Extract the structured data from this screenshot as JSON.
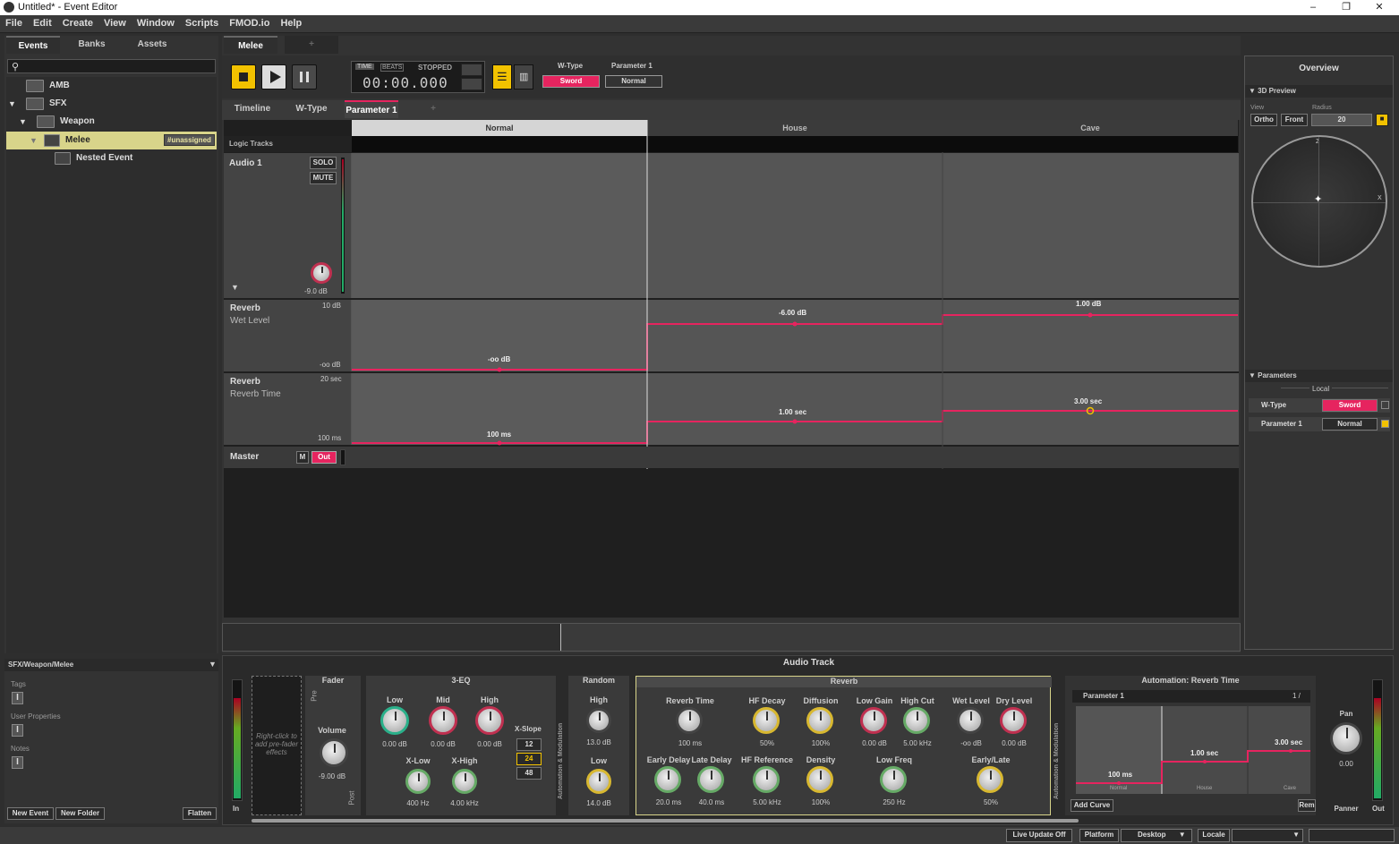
{
  "window": {
    "title": "Untitled* - Event Editor",
    "min": "–",
    "max": "❐",
    "close": "✕"
  },
  "menu": [
    "File",
    "Edit",
    "Create",
    "View",
    "Window",
    "Scripts",
    "FMOD.io",
    "Help"
  ],
  "browser": {
    "tabs": [
      "Events",
      "Banks",
      "Assets"
    ],
    "search_placeholder": "",
    "tree": [
      {
        "label": "AMB",
        "level": 0
      },
      {
        "label": "SFX",
        "level": 0
      },
      {
        "label": "Weapon",
        "level": 1
      },
      {
        "label": "Melee",
        "level": 2,
        "badge": "#unassigned"
      },
      {
        "label": "Nested Event",
        "level": 3
      }
    ],
    "path": "SFX/Weapon/Melee",
    "sections": [
      "Tags",
      "User Properties",
      "Notes"
    ],
    "buttons": {
      "new_event": "New Event",
      "new_folder": "New Folder",
      "flatten": "Flatten"
    }
  },
  "editor": {
    "event_tabs": [
      "Melee",
      "+"
    ],
    "transport": {
      "time_label": "TIME",
      "beats_label": "BEATS",
      "status": "STOPPED",
      "timecode": "00:00.000"
    },
    "param_widgets": [
      {
        "label": "W-Type",
        "value": "Sword"
      },
      {
        "label": "Parameter 1",
        "value": "Normal"
      }
    ],
    "sheet_tabs": [
      "Timeline",
      "W-Type",
      "Parameter 1",
      "+"
    ],
    "columns": [
      "Normal",
      "House",
      "Cave"
    ],
    "logic_tracks": "Logic Tracks",
    "audio_track": {
      "name": "Audio 1",
      "solo": "SOLO",
      "mute": "MUTE",
      "volume": "-9.0 dB"
    },
    "automation_tracks": [
      {
        "effect": "Reverb",
        "param": "Wet Level",
        "max": "10 dB",
        "min": "-oo dB",
        "points": [
          {
            "label": "-oo dB"
          },
          {
            "label": "-6.00 dB"
          },
          {
            "label": "1.00 dB"
          }
        ]
      },
      {
        "effect": "Reverb",
        "param": "Reverb Time",
        "max": "20 sec",
        "min": "100 ms",
        "points": [
          {
            "label": "100 ms"
          },
          {
            "label": "1.00 sec"
          },
          {
            "label": "3.00 sec"
          }
        ]
      }
    ],
    "master": {
      "name": "Master",
      "m": "M",
      "out": "Out"
    }
  },
  "overview": {
    "title": "Overview",
    "preview": {
      "title": "3D Preview",
      "view_label": "View",
      "radius_label": "Radius",
      "ortho": "Ortho",
      "front": "Front",
      "radius": "20",
      "z": "Z",
      "x": "X"
    },
    "parameters": {
      "title": "Parameters",
      "local": "Local",
      "items": [
        {
          "name": "W-Type",
          "value": "Sword"
        },
        {
          "name": "Parameter 1",
          "value": "Normal"
        }
      ]
    }
  },
  "deck": {
    "title": "Audio Track",
    "in": "In",
    "out": "Out",
    "prefader_hint": "Right-click to add pre-fader effects",
    "fader": {
      "title": "Fader",
      "pre": "Pre",
      "post": "Post",
      "volume_label": "Volume",
      "volume": "-9.00 dB"
    },
    "eq": {
      "title": "3-EQ",
      "knobs": [
        {
          "label": "Low",
          "value": "0.00 dB"
        },
        {
          "label": "Mid",
          "value": "0.00 dB"
        },
        {
          "label": "High",
          "value": "0.00 dB"
        },
        {
          "label": "X-Low",
          "value": "400 Hz"
        },
        {
          "label": "X-High",
          "value": "4.00 kHz"
        }
      ],
      "xslope_label": "X-Slope",
      "slopes": [
        "12",
        "24",
        "48"
      ]
    },
    "automation_side": "Automation & Modulation",
    "random": {
      "title": "Random",
      "knobs": [
        {
          "label": "High",
          "value": "13.0 dB"
        },
        {
          "label": "Low",
          "value": "14.0 dB"
        }
      ]
    },
    "reverb": {
      "title": "Reverb",
      "knobs": [
        {
          "label": "Reverb Time",
          "value": "100 ms"
        },
        {
          "label": "HF Decay",
          "value": "50%"
        },
        {
          "label": "Diffusion",
          "value": "100%"
        },
        {
          "label": "Low Gain",
          "value": "0.00 dB"
        },
        {
          "label": "High Cut",
          "value": "5.00 kHz"
        },
        {
          "label": "Wet Level",
          "value": "-oo dB"
        },
        {
          "label": "Dry Level",
          "value": "0.00 dB"
        },
        {
          "label": "Early Delay",
          "value": "20.0 ms"
        },
        {
          "label": "Late Delay",
          "value": "40.0 ms"
        },
        {
          "label": "HF Reference",
          "value": "5.00 kHz"
        },
        {
          "label": "Density",
          "value": "100%"
        },
        {
          "label": "Low Freq",
          "value": "250 Hz"
        },
        {
          "label": "Early/Late",
          "value": "50%"
        }
      ]
    },
    "automation": {
      "title": "Automation: Reverb Time",
      "param": "Parameter 1",
      "page": "1 /",
      "labels": [
        "100 ms",
        "1.00 sec",
        "3.00 sec"
      ],
      "cols": [
        "Normal",
        "House",
        "Cave"
      ],
      "add_curve": "Add Curve",
      "rem": "Rem"
    },
    "panner": {
      "label": "Pan",
      "value": "0.00",
      "name": "Panner"
    }
  },
  "statusbar": {
    "live_update": "Live Update Off",
    "platform_label": "Platform",
    "platform": "Desktop",
    "locale_label": "Locale"
  },
  "colors": {
    "accent": "#e6245f",
    "highlight": "#d8d48a",
    "transport_yellow": "#f2c200"
  }
}
